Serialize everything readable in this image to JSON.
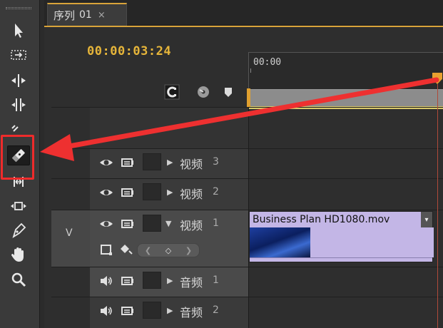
{
  "tabs": {
    "title": "序列",
    "number": "01",
    "close": "×"
  },
  "timecode": "00:00:03:24",
  "ruler": {
    "label": "00:00"
  },
  "tools": [
    {
      "name": "selection-tool-icon"
    },
    {
      "name": "track-select-tool-icon"
    },
    {
      "name": "ripple-edit-tool-icon"
    },
    {
      "name": "rolling-edit-tool-icon"
    },
    {
      "name": "rate-stretch-tool-icon"
    },
    {
      "name": "razor-tool-icon",
      "active": true
    },
    {
      "name": "slip-tool-icon"
    },
    {
      "name": "slide-tool-icon"
    },
    {
      "name": "pen-tool-icon"
    },
    {
      "name": "hand-tool-icon"
    },
    {
      "name": "zoom-tool-icon"
    }
  ],
  "tracks": {
    "video3": {
      "name": "视频",
      "num": "3"
    },
    "video2": {
      "name": "视频",
      "num": "2"
    },
    "video1": {
      "name": "视频",
      "num": "1",
      "target": "V"
    },
    "audio1": {
      "name": "音频",
      "num": "1"
    },
    "audio2": {
      "name": "音频",
      "num": "2"
    }
  },
  "clip": {
    "name": "Business Plan HD1080.mov",
    "menu": "▾"
  },
  "colors": {
    "accent": "#d9a43a",
    "timecode": "#e6b53a",
    "clip": "#c3b6e6",
    "annotation": "#ee2b2b"
  }
}
